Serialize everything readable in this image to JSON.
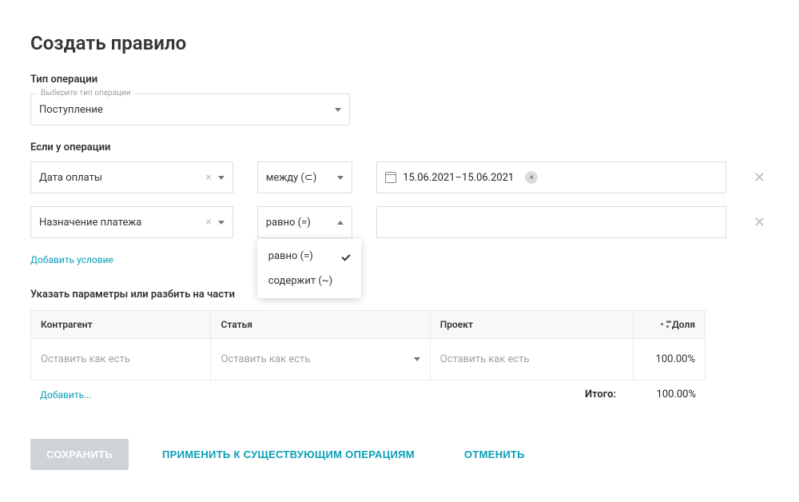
{
  "title": "Создать правило",
  "operation_type": {
    "label": "Тип операции",
    "floating": "Выберите тип операции",
    "value": "Поступление"
  },
  "conditions_label": "Если у операции",
  "conditions": [
    {
      "field": "Дата оплаты",
      "op": "между (⊂)",
      "value": "15.06.2021–15.06.2021"
    },
    {
      "field": "Назначение платежа",
      "op": "равно (=)",
      "value": ""
    }
  ],
  "op_dropdown": {
    "option1": "равно (=)",
    "option2": "содержит (~)"
  },
  "add_condition": "Добавить условие",
  "split_label": "Указать параметры или разбить на части",
  "table": {
    "headers": {
      "counterparty": "Контрагент",
      "article": "Статья",
      "project": "Проект",
      "share": "Доля"
    },
    "row": {
      "counterparty_ph": "Оставить как есть",
      "article_ph": "Оставить как есть",
      "project_ph": "Оставить как есть",
      "share": "100.00%"
    },
    "add": "Добавить...",
    "total_label": "Итого:",
    "total_value": "100.00%"
  },
  "actions": {
    "save": "СОХРАНИТЬ",
    "apply": "ПРИМЕНИТЬ К СУЩЕСТВУЮЩИМ ОПЕРАЦИЯМ",
    "cancel": "ОТМЕНИТЬ"
  }
}
